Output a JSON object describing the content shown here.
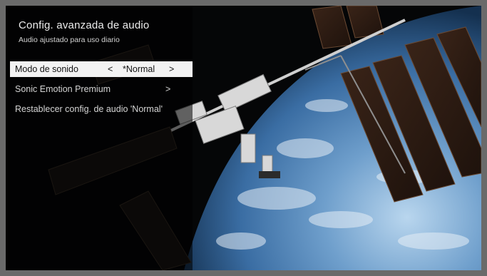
{
  "menu": {
    "title": "Config. avanzada de audio",
    "subtitle": "Audio ajustado para uso diario",
    "items": [
      {
        "label": "Modo de sonido",
        "left_arrow": "<",
        "value": "*Normal",
        "right_arrow": ">"
      },
      {
        "label": "Sonic Emotion Premium",
        "right_arrow": ">"
      },
      {
        "label": "Restablecer config. de audio 'Normal'"
      }
    ]
  },
  "background": {
    "description_icon": "space-station-image",
    "accent": "#f3f3f3"
  }
}
